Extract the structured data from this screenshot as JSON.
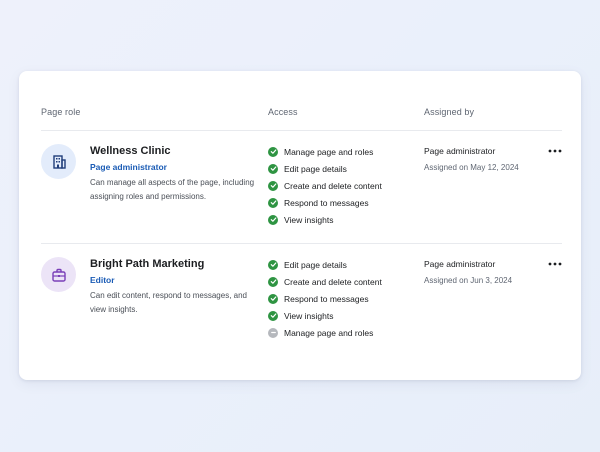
{
  "table": {
    "headers": {
      "page_role": "Page role",
      "access": "Access",
      "assigned_by": "Assigned by"
    }
  },
  "rows": [
    {
      "name": "Wellness Clinic",
      "role": "Page administrator",
      "description": "Can manage all aspects of the page, including assigning roles and permissions.",
      "icon": "building-icon",
      "icon_color": "#1f3d7a",
      "icon_bg": "#e3ecfb",
      "access": [
        {
          "label": "Manage page and roles",
          "enabled": true
        },
        {
          "label": "Edit page details",
          "enabled": true
        },
        {
          "label": "Create and delete content",
          "enabled": true
        },
        {
          "label": "Respond to messages",
          "enabled": true
        },
        {
          "label": "View insights",
          "enabled": true
        }
      ],
      "assigned_by": "Page administrator",
      "assigned_on": "Assigned on May 12, 2024"
    },
    {
      "name": "Bright Path Marketing",
      "role": "Editor",
      "description": "Can edit content, respond to messages, and view insights.",
      "icon": "briefcase-icon",
      "icon_color": "#7a3fb8",
      "icon_bg": "#ece4f7",
      "access": [
        {
          "label": "Edit page details",
          "enabled": true
        },
        {
          "label": "Create and delete content",
          "enabled": true
        },
        {
          "label": "Respond to messages",
          "enabled": true
        },
        {
          "label": "View insights",
          "enabled": true
        },
        {
          "label": "Manage page and roles",
          "enabled": false
        }
      ],
      "assigned_by": "Page administrator",
      "assigned_on": "Assigned on Jun 3, 2024"
    }
  ],
  "colors": {
    "accent": "#1a5bb5",
    "check_enabled": "#2e9442",
    "check_disabled": "#b5b8bd"
  }
}
